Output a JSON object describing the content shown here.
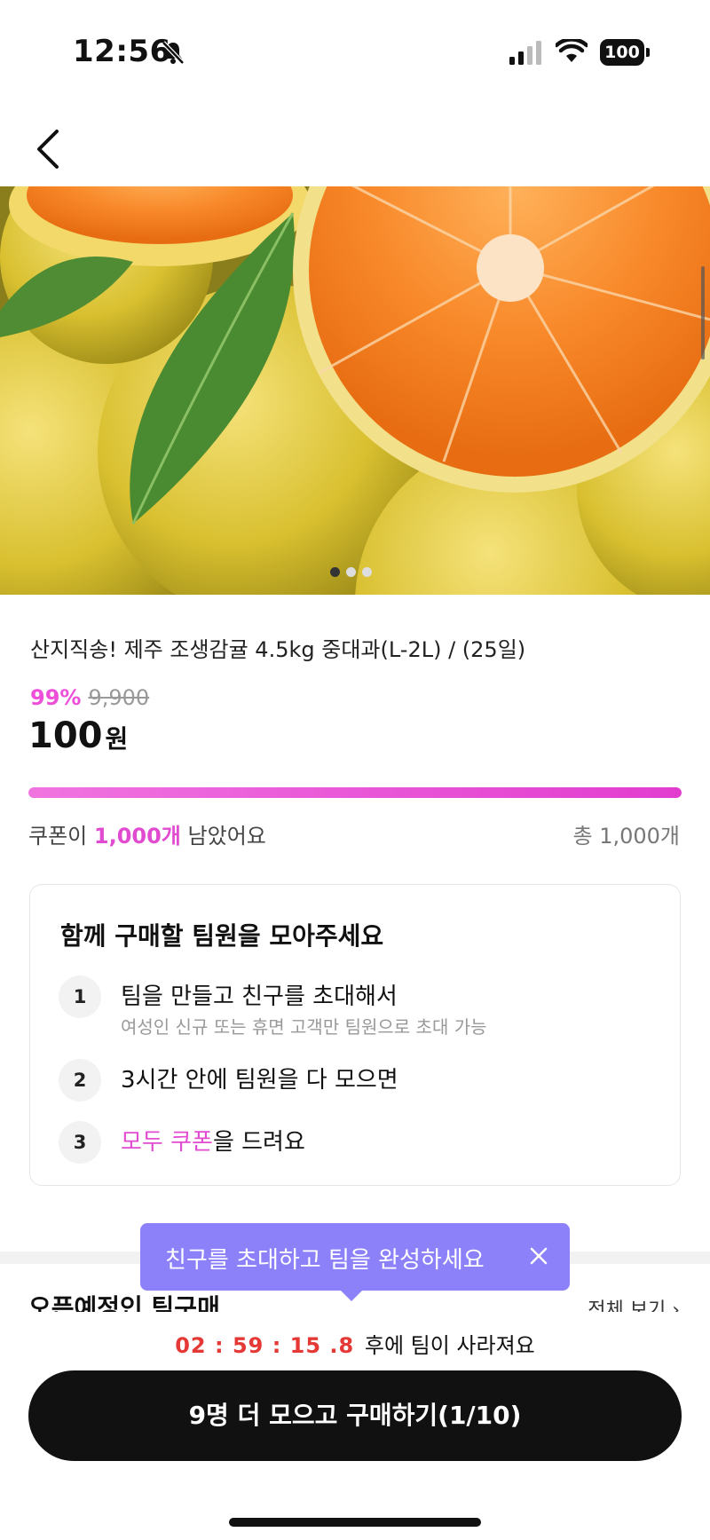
{
  "status_bar": {
    "time": "12:56",
    "battery": "100"
  },
  "colors": {
    "accent_pink": "#e04bd0",
    "tooltip_purple": "#8c81f8",
    "timer_red": "#e53935",
    "cta_black": "#111111"
  },
  "product": {
    "image_carousel": {
      "total_images": 3,
      "active_index": 0
    },
    "title": "산지직송! 제주 조생감귤 4.5kg 중대과(L-2L) / (25일)",
    "discount": "99%",
    "original_price": "9,900",
    "price": "100",
    "price_unit": "원"
  },
  "coupon": {
    "progress_fraction": 1.0,
    "prefix": "쿠폰이",
    "remaining": "1,000개",
    "suffix": "남았어요",
    "total": "총 1,000개"
  },
  "team_card": {
    "title": "함께 구매할 팀원을 모아주세요",
    "steps": [
      {
        "num": "1",
        "text": "팀을 만들고 친구를 초대해서",
        "sub": "여성인 신규 또는 휴면 고객만 팀원으로 초대 가능"
      },
      {
        "num": "2",
        "text": "3시간 안에 팀원을 다 모으면"
      },
      {
        "num": "3",
        "highlight": "모두 쿠폰",
        "text": "을 드려요"
      }
    ]
  },
  "section": {
    "title": "오픈예정인 팀구매",
    "see_all": "전체 보기 ›"
  },
  "tooltip": {
    "text": "친구를 초대하고 팀을 완성하세요"
  },
  "timer": {
    "value": "02 : 59 : 15 .8",
    "label": "후에 팀이 사라져요"
  },
  "cta": {
    "label": "9명 더 모으고 구매하기(1/10)"
  }
}
